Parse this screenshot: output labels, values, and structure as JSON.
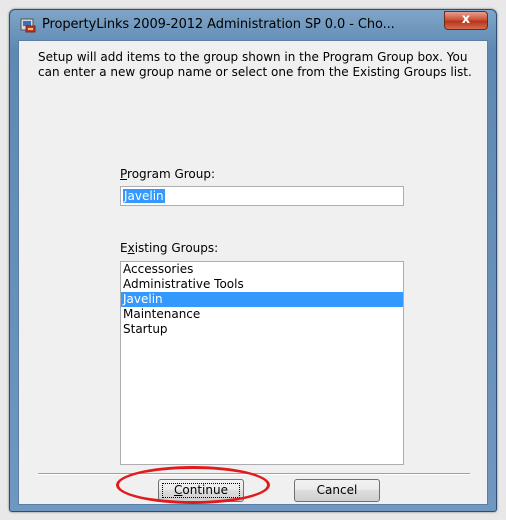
{
  "window": {
    "title": "PropertyLinks 2009-2012 Administration SP 0.0 - Cho...",
    "close_label": "x"
  },
  "intro_text": "Setup will add items to the group shown in the Program Group box. You can enter a new group name or select one from the Existing Groups list.",
  "program_group": {
    "label_accel": "P",
    "label_rest": "rogram Group:",
    "value": "Javelin"
  },
  "existing_groups": {
    "label_start": "E",
    "label_accel": "x",
    "label_rest": "isting Groups:",
    "items": [
      "Accessories",
      "Administrative Tools",
      "Javelin",
      "Maintenance",
      "Startup"
    ],
    "selected": "Javelin"
  },
  "buttons": {
    "continue_accel": "C",
    "continue_rest": "ontinue",
    "cancel": "Cancel"
  },
  "colors": {
    "selection": "#3399ff",
    "annotation": "#e11b1b"
  }
}
